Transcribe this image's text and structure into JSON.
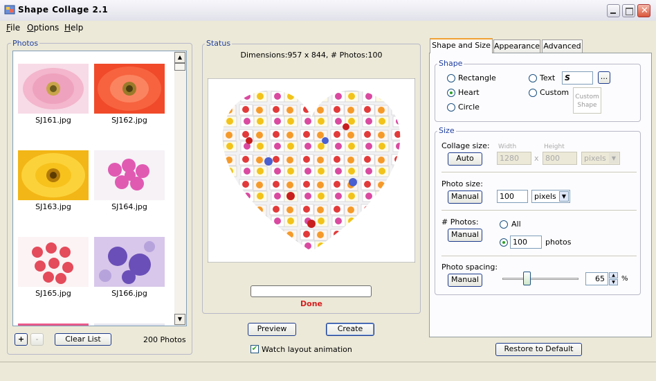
{
  "window": {
    "title": "Shape Collage 2.1"
  },
  "menu": {
    "file": "File",
    "options": "Options",
    "help": "Help"
  },
  "photos": {
    "label": "Photos",
    "items": [
      {
        "name": "SJ161.jpg"
      },
      {
        "name": "SJ162.jpg"
      },
      {
        "name": "SJ163.jpg"
      },
      {
        "name": "SJ164.jpg"
      },
      {
        "name": "SJ165.jpg"
      },
      {
        "name": "SJ166.jpg"
      }
    ],
    "add": "+",
    "remove": "-",
    "clear_list": "Clear List",
    "count": "200 Photos"
  },
  "status": {
    "label": "Status",
    "dimensions": "Dimensions:957 x 844, # Photos:100",
    "progress": 0,
    "done": "Done"
  },
  "actions": {
    "preview": "Preview",
    "create": "Create",
    "watch_label": "Watch layout animation",
    "watch_checked": true
  },
  "tabs": [
    "Shape and Size",
    "Appearance",
    "Advanced"
  ],
  "shape": {
    "label": "Shape",
    "rectangle": "Rectangle",
    "heart": "Heart",
    "circle": "Circle",
    "text": "Text",
    "text_value": "S",
    "browse": "...",
    "custom": "Custom",
    "custom_shape_line1": "Custom",
    "custom_shape_line2": "Shape",
    "selected": "heart"
  },
  "size": {
    "label": "Size",
    "collage_size_label": "Collage size:",
    "auto": "Auto",
    "width_label": "Width",
    "height_label": "Height",
    "width": "1280",
    "x": "x",
    "height": "800",
    "units_disabled": "pixels",
    "photo_size_label": "Photo size:",
    "manual": "Manual",
    "photo_size": "100",
    "photo_units": "pixels",
    "num_photos_label": "# Photos:",
    "all": "All",
    "num_photos": "100",
    "photos_word": "photos",
    "spacing_label": "Photo spacing:",
    "spacing_value": "65",
    "percent": "%"
  },
  "restore": "Restore to Default",
  "colors": {
    "accent": "#1f3f9f",
    "done": "#d42020"
  }
}
